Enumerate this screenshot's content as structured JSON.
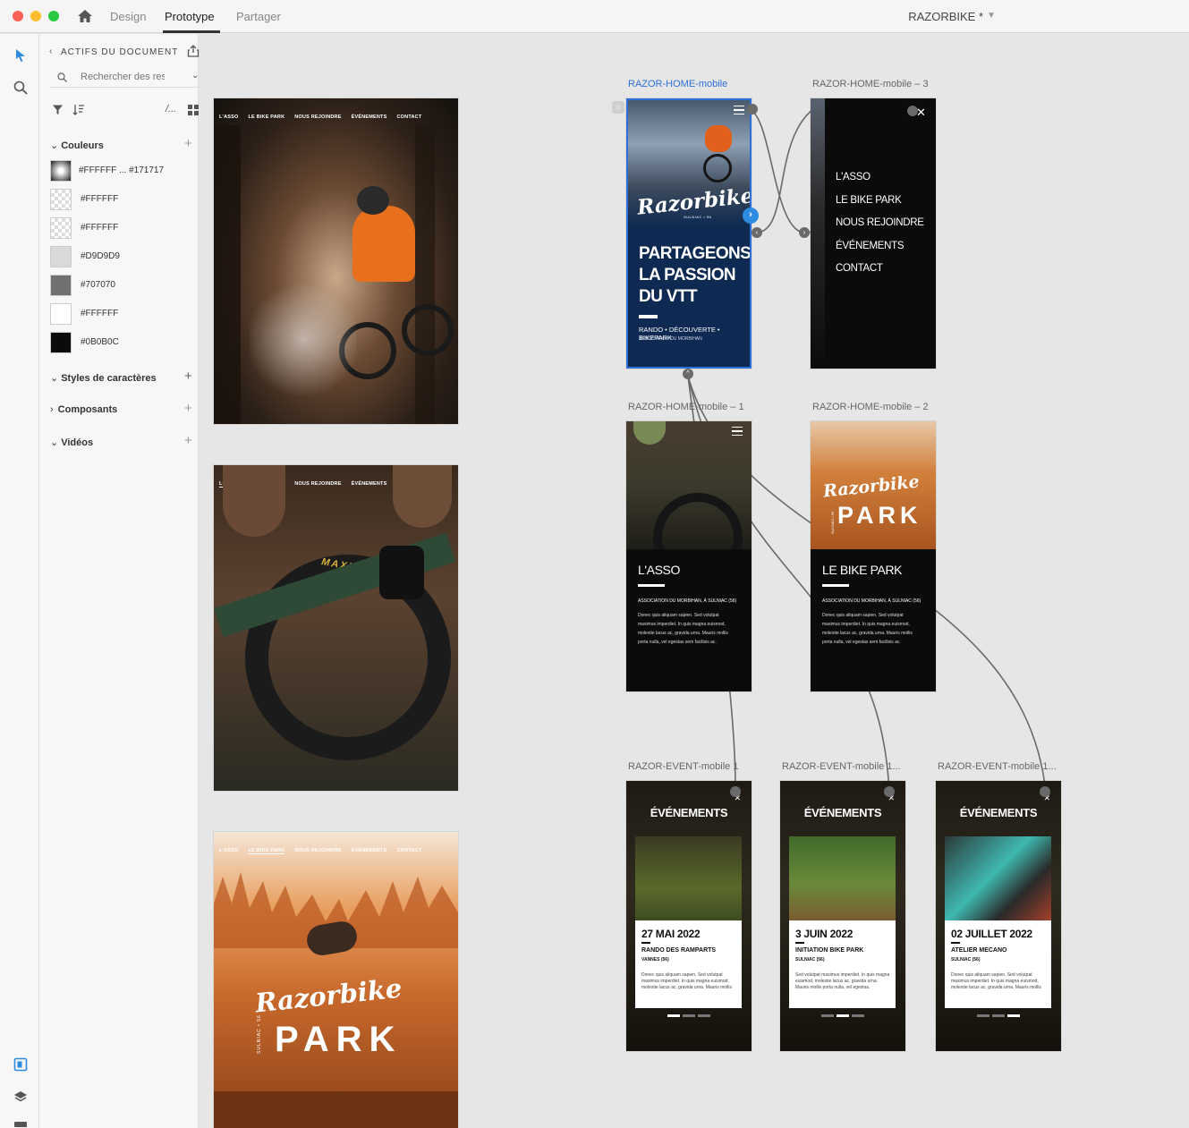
{
  "titlebar": {
    "tabs": [
      {
        "label": "Design"
      },
      {
        "label": "Prototype"
      },
      {
        "label": "Partager"
      }
    ],
    "active_tab": "Prototype",
    "document_title": "RAZORBIKE *"
  },
  "sidebar": {
    "header": "ACTIFS DU DOCUMENT",
    "search_placeholder": "Rechercher des ressources",
    "sections": {
      "colors": "Couleurs",
      "char_styles": "Styles de caractères",
      "components": "Composants",
      "videos": "Vidéos"
    },
    "swatches": [
      {
        "label": "#FFFFFF ... #171717",
        "color": "gradient"
      },
      {
        "label": "#FFFFFF",
        "color": "#FFFFFF",
        "transparent": true
      },
      {
        "label": "#FFFFFF",
        "color": "#FFFFFF",
        "transparent": true
      },
      {
        "label": "#D9D9D9",
        "color": "#D9D9D9"
      },
      {
        "label": "#707070",
        "color": "#707070"
      },
      {
        "label": "#FFFFFF",
        "color": "#FFFFFF"
      },
      {
        "label": "#0B0B0C",
        "color": "#0B0B0C"
      }
    ]
  },
  "desktop_nav": [
    "L'ASSO",
    "LE BIKE PARK",
    "NOUS REJOINDRE",
    "ÉVÉNEMENTS",
    "CONTACT"
  ],
  "artboards": {
    "home": {
      "title": "RAZOR-HOME-mobile",
      "brand": "Razorbike",
      "brand_sub": "SULNIAC • 56",
      "headline": [
        "PARTAGEONS",
        "LA PASSION",
        "DU VTT"
      ],
      "tagline": "RANDO • DÉCOUVERTE • BIKEPARK",
      "subtag": "ASSOCIATION DU MORBIHAN"
    },
    "menu": {
      "title": "RAZOR-HOME-mobile – 3",
      "items": [
        "L'ASSO",
        "LE BIKE PARK",
        "NOUS REJOINDRE",
        "ÉVÉNEMENTS",
        "CONTACT"
      ]
    },
    "asso": {
      "title": "RAZOR-HOME-mobile – 1",
      "heading": "L'ASSO",
      "subtitle": "ASSOCIATION DU MORBIHAN, À SULNIAC (56)",
      "body": "Donec quis aliquam sapien. Sed volutpat maximus imperdiet. In quis magna euismod, molestie lacus ac, gravida urna. Mauris mollis porta nulla, vel egestas sem facilisis ac."
    },
    "park": {
      "title": "RAZOR-HOME-mobile – 2",
      "brand": "Razorbike",
      "word": "PARK",
      "brand_sub": "SULNIAC • 56",
      "heading": "LE BIKE PARK",
      "subtitle": "ASSOCIATION DU MORBIHAN, À SULNIAC (56)",
      "body": "Donec quis aliquam sapien. Sed volutpat maximus imperdiet. In quis magna euismod, molestie lacus ac, gravida urna. Mauris mollis porta nulla, vel egestas sem facilisis ac."
    },
    "events": [
      {
        "title": "RAZOR-EVENT-mobile 1",
        "heading": "ÉVÉNEMENTS",
        "date": "27 MAI 2022",
        "name": "RANDO DES RAMPARTS",
        "loc": "VANNES (56)",
        "body": "Donec quis aliquam sapien. Sed volutpat maximus imperdiet. In quis magna euismod, molestie lacus ac, gravida urna. Mauris mollis",
        "active_dot": 0
      },
      {
        "title": "RAZOR-EVENT-mobile 1...",
        "heading": "ÉVÉNEMENTS",
        "date": "3 JUIN 2022",
        "name": "INITIATION BIKE PARK",
        "loc": "SULNIAC (56)",
        "body": "Sed volutpat maximus imperdiet. In quis magna euismod, molestie lacus ac, gravida urna. Mauris mollis porta nulla, vel egestas.",
        "active_dot": 1
      },
      {
        "title": "RAZOR-EVENT-mobile 1...",
        "heading": "ÉVÉNEMENTS",
        "date": "02 JUILLET 2022",
        "name": "ATELIER MECANO",
        "loc": "SULNIAC (56)",
        "body": "Donec quis aliquam sapien. Sed volutpat maximus imperdiet. In quis magna euismod, molestie lacus ac, gravida urna. Mauris mollis",
        "active_dot": 2
      }
    ],
    "desktop_park": {
      "brand": "Razorbike",
      "word": "PARK",
      "brand_sub": "SULNIAC • 56"
    },
    "desktop_tire_brand": "MAXXI"
  },
  "colors": {
    "accent": "#2d6fd9",
    "home_bg": "#0f2a52",
    "dark": "#0b0b0c"
  }
}
